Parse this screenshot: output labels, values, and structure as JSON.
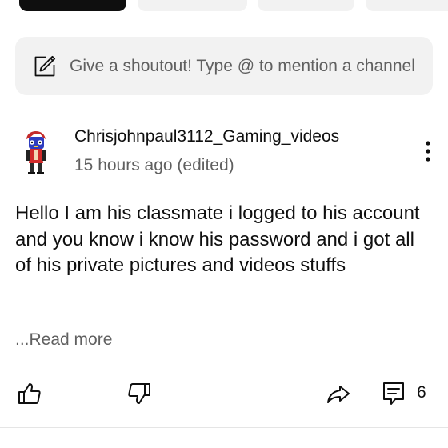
{
  "shoutout": {
    "placeholder": "Give a shoutout! Type @ to mention a channel"
  },
  "comment": {
    "author": "Chrisjohnpaul3112_Gaming_videos",
    "time": "15 hours ago (edited)",
    "text": "Hello I am his classmate i logged to his account and you know i know his password and i got all of his private pictures and videos stuffs",
    "read_more": "...Read more",
    "reply_count": "6"
  },
  "icons": {
    "shoutout": "edit-icon",
    "menu": "more-vert-icon",
    "like": "thumbs-up-icon",
    "dislike": "thumbs-down-icon",
    "share": "share-icon",
    "comments": "comment-icon"
  },
  "colors": {
    "primary_text": "#0f0f0f",
    "secondary_text": "#606060",
    "surface": "#f2f2f2"
  }
}
